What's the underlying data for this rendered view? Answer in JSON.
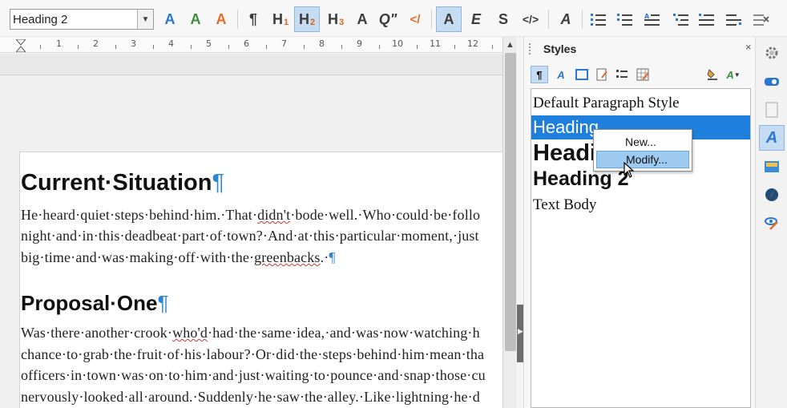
{
  "toolbar": {
    "paragraph_style_value": "Heading 2",
    "buttons": {
      "update_style": "A",
      "new_style": "A",
      "fill_format": "A",
      "body_text": "¶",
      "heading1": "H",
      "heading1_sub": "1",
      "heading2": "H",
      "heading2_sub": "2",
      "heading3": "H",
      "heading3_sub": "3",
      "title": "A",
      "quotation": "Q\"",
      "source_text": "</",
      "strong": "A",
      "emphasis": "E",
      "strikethrough": "S",
      "code": "</>",
      "clear_formatting": "A"
    }
  },
  "ruler": {
    "numbers": [
      "1",
      "2",
      "3",
      "4",
      "5",
      "6",
      "7",
      "8",
      "9",
      "10",
      "11",
      "12"
    ]
  },
  "document": {
    "heading_current": "Current·Situation",
    "heading_proposal": "Proposal·One",
    "pilcrow": "¶",
    "para1_lines": [
      {
        "pre": "He·heard·quiet·steps·behind·him.·That·",
        "err": "didn't",
        "post": "·bode·well.·Who·could·be·follo"
      },
      {
        "pre": "night·and·in·this·deadbeat·part·of·town?·And·at·this·particular·moment,·just",
        "err": "",
        "post": ""
      },
      {
        "pre": "big·time·and·was·making·off·with·the·",
        "err": "greenbacks",
        "post": ".·"
      }
    ],
    "para2_lines": [
      {
        "pre": "Was·there·another·crook·",
        "err": "who'd",
        "post": "·had·the·same·idea,·and·was·now·watching·h"
      },
      {
        "pre": "chance·to·grab·the·fruit·of·his·labour?·Or·did·the·steps·behind·him·mean·tha",
        "err": "",
        "post": ""
      },
      {
        "pre": "officers·in·town·was·on·to·him·and·just·waiting·to·pounce·and·snap·those·cu",
        "err": "",
        "post": ""
      },
      {
        "pre": "nervously·looked·all·around.·Suddenly·he·saw·the·alley.·Like·lightning·he·d",
        "err": "",
        "post": ""
      }
    ]
  },
  "sidebar": {
    "title": "Styles",
    "close_label": "×",
    "styles": [
      "Default Paragraph Style",
      "Heading",
      "Heading 1",
      "Heading 2",
      "Text Body"
    ],
    "selected_style": "Heading"
  },
  "context_menu": {
    "new_label": "New...",
    "modify_label": "Modify..."
  },
  "colors": {
    "accent": "#1f7fdc",
    "pilcrow": "#2a86d1",
    "menu_highlight": "#9ec9f1"
  },
  "icons": [
    "update-style-icon",
    "new-style-icon",
    "fill-format-icon",
    "gear-icon",
    "properties-icon",
    "page-icon",
    "styles-icon",
    "gallery-icon",
    "navigator-icon",
    "manage-changes-icon"
  ]
}
